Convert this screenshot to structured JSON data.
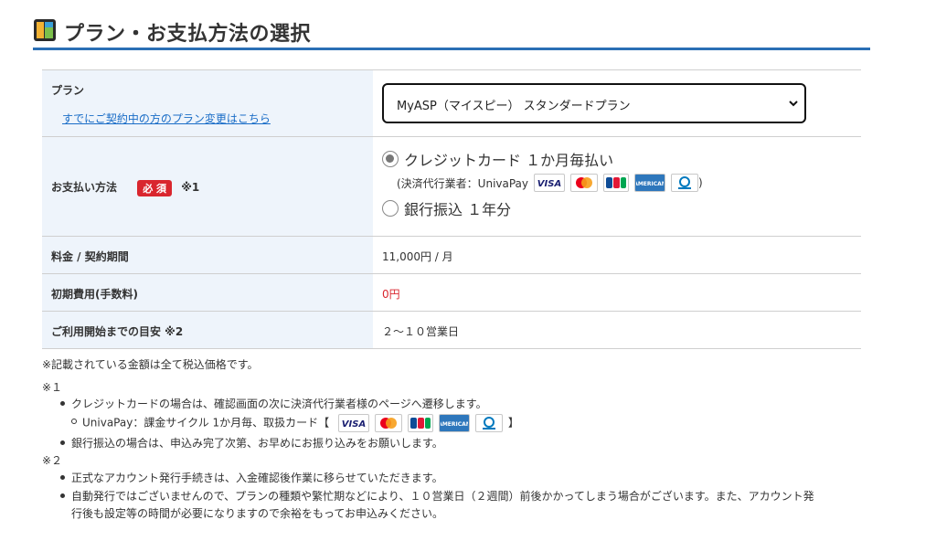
{
  "header": {
    "title": "プラン・お支払方法の選択",
    "icon": "notebook-icon",
    "accent": "#2a6fb5"
  },
  "rows": {
    "plan": {
      "label": "プラン",
      "change_link": "すでにご契約中の方のプラン変更はこちら",
      "select_value": "MyASP（マイスピー） スタンダードプラン"
    },
    "payment": {
      "label": "お支払い方法",
      "required_badge": "必 須",
      "note_ref": "※1",
      "options": [
        {
          "label": "クレジットカード １か月毎払い",
          "checked": true
        },
        {
          "label": "銀行振込 １年分",
          "checked": false
        }
      ],
      "agent_open": "(決済代行業者：UnivaPay",
      "agent_close": ")",
      "cards": [
        "VISA",
        "Mastercard",
        "JCB",
        "AMEX",
        "Diners Club"
      ]
    },
    "fee": {
      "label": "料金 / 契約期間",
      "value": "11,000円 / 月"
    },
    "initial": {
      "label": "初期費用(手数料)",
      "value": "0円"
    },
    "start": {
      "label": "ご利用開始までの目安 ※2",
      "value": "２～１０営業日"
    }
  },
  "notes": {
    "tax": "※記載されている金額は全て税込価格です。",
    "ref1": "※１",
    "n1_bullet1": "クレジットカードの場合は、確認画面の次に決済代行業者様のページへ遷移します。",
    "n1_sub_prefix": "UnivaPay：課金サイクル 1か月毎、取扱カード【",
    "n1_sub_suffix": "】",
    "n1_bullet2": "銀行振込の場合は、申込み完了次第、お早めにお振り込みをお願いします。",
    "ref2": "※２",
    "n2_bullet1": "正式なアカウント発行手続きは、入金確認後作業に移らせていただきます。",
    "n2_bullet2a": "自動発行ではございませんので、プランの種類や繁忙期などにより、１０営業日（２週間）前後かかってしまう場合がございます。また、アカウント発",
    "n2_bullet2b": "行後も設定等の時間が必要になりますので余裕をもってお申込みください。"
  }
}
